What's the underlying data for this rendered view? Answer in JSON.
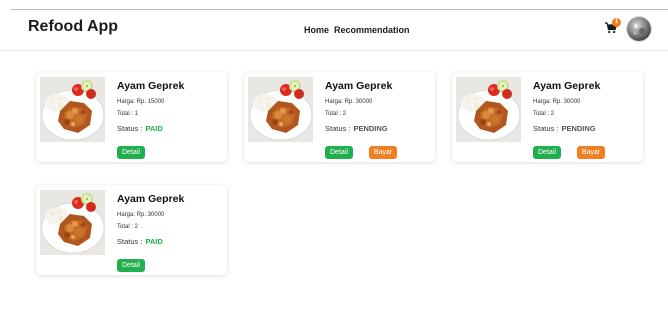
{
  "header": {
    "brand": "Refood App",
    "nav": [
      "Home",
      "Recommendation"
    ],
    "cart_count": "1"
  },
  "orders": [
    {
      "name": "Ayam Geprek",
      "price": "Harga: Rp. 15000",
      "total": "Total : 1",
      "status_label": "Status :",
      "status": "PAID",
      "detail_label": "Detail",
      "pay_label": ""
    },
    {
      "name": "Ayam Geprek",
      "price": "Harga: Rp. 30000",
      "total": "Total : 2",
      "status_label": "Status :",
      "status": "PENDING",
      "detail_label": "Detail",
      "pay_label": "Bayar"
    },
    {
      "name": "Ayam Geprek",
      "price": "Harga: Rp. 30000",
      "total": "Total : 2",
      "status_label": "Status :",
      "status": "PENDING",
      "detail_label": "Detail",
      "pay_label": "Bayar"
    },
    {
      "name": "Ayam Geprek",
      "price": "Harga: Rp. 30000",
      "total": "Total : 2",
      "status_label": "Status :",
      "status": "PAID",
      "detail_label": "Detail",
      "pay_label": ""
    }
  ],
  "colors": {
    "paid": "#23b14a",
    "detail_button": "#22b04f",
    "pay_button": "#f17e20",
    "cart_badge": "#f07c1a"
  },
  "icons": {
    "cart": "cart-icon",
    "avatar": "avatar-image",
    "food": "fried-chicken-rice-photo"
  }
}
